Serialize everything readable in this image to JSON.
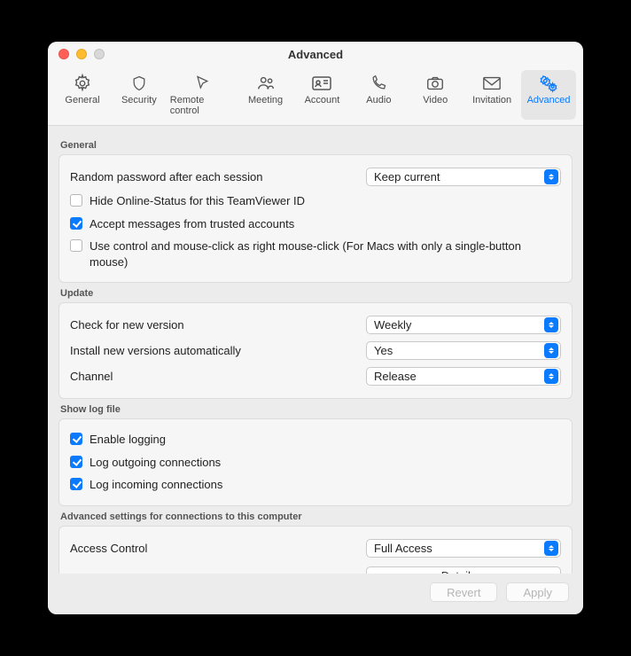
{
  "window": {
    "title": "Advanced"
  },
  "tabs": [
    {
      "label": "General"
    },
    {
      "label": "Security"
    },
    {
      "label": "Remote control"
    },
    {
      "label": "Meeting"
    },
    {
      "label": "Account"
    },
    {
      "label": "Audio"
    },
    {
      "label": "Video"
    },
    {
      "label": "Invitation"
    },
    {
      "label": "Advanced"
    }
  ],
  "sections": {
    "general": {
      "title": "General",
      "random_pw_label": "Random password after each session",
      "random_pw_value": "Keep current",
      "hide_online_label": "Hide Online-Status for this TeamViewer ID",
      "accept_msgs_label": "Accept messages from trusted accounts",
      "right_click_label": "Use control and mouse-click as right mouse-click (For Macs with only a single-button mouse)"
    },
    "update": {
      "title": "Update",
      "check_label": "Check for new version",
      "check_value": "Weekly",
      "install_label": "Install new versions automatically",
      "install_value": "Yes",
      "channel_label": "Channel",
      "channel_value": "Release"
    },
    "log": {
      "title": "Show log file",
      "enable_label": "Enable logging",
      "outgoing_label": "Log outgoing connections",
      "incoming_label": "Log incoming connections"
    },
    "access": {
      "title": "Advanced settings for connections to this computer",
      "access_label": "Access Control",
      "access_value": "Full Access",
      "details_label": "Details..."
    }
  },
  "footer": {
    "revert": "Revert",
    "apply": "Apply"
  }
}
